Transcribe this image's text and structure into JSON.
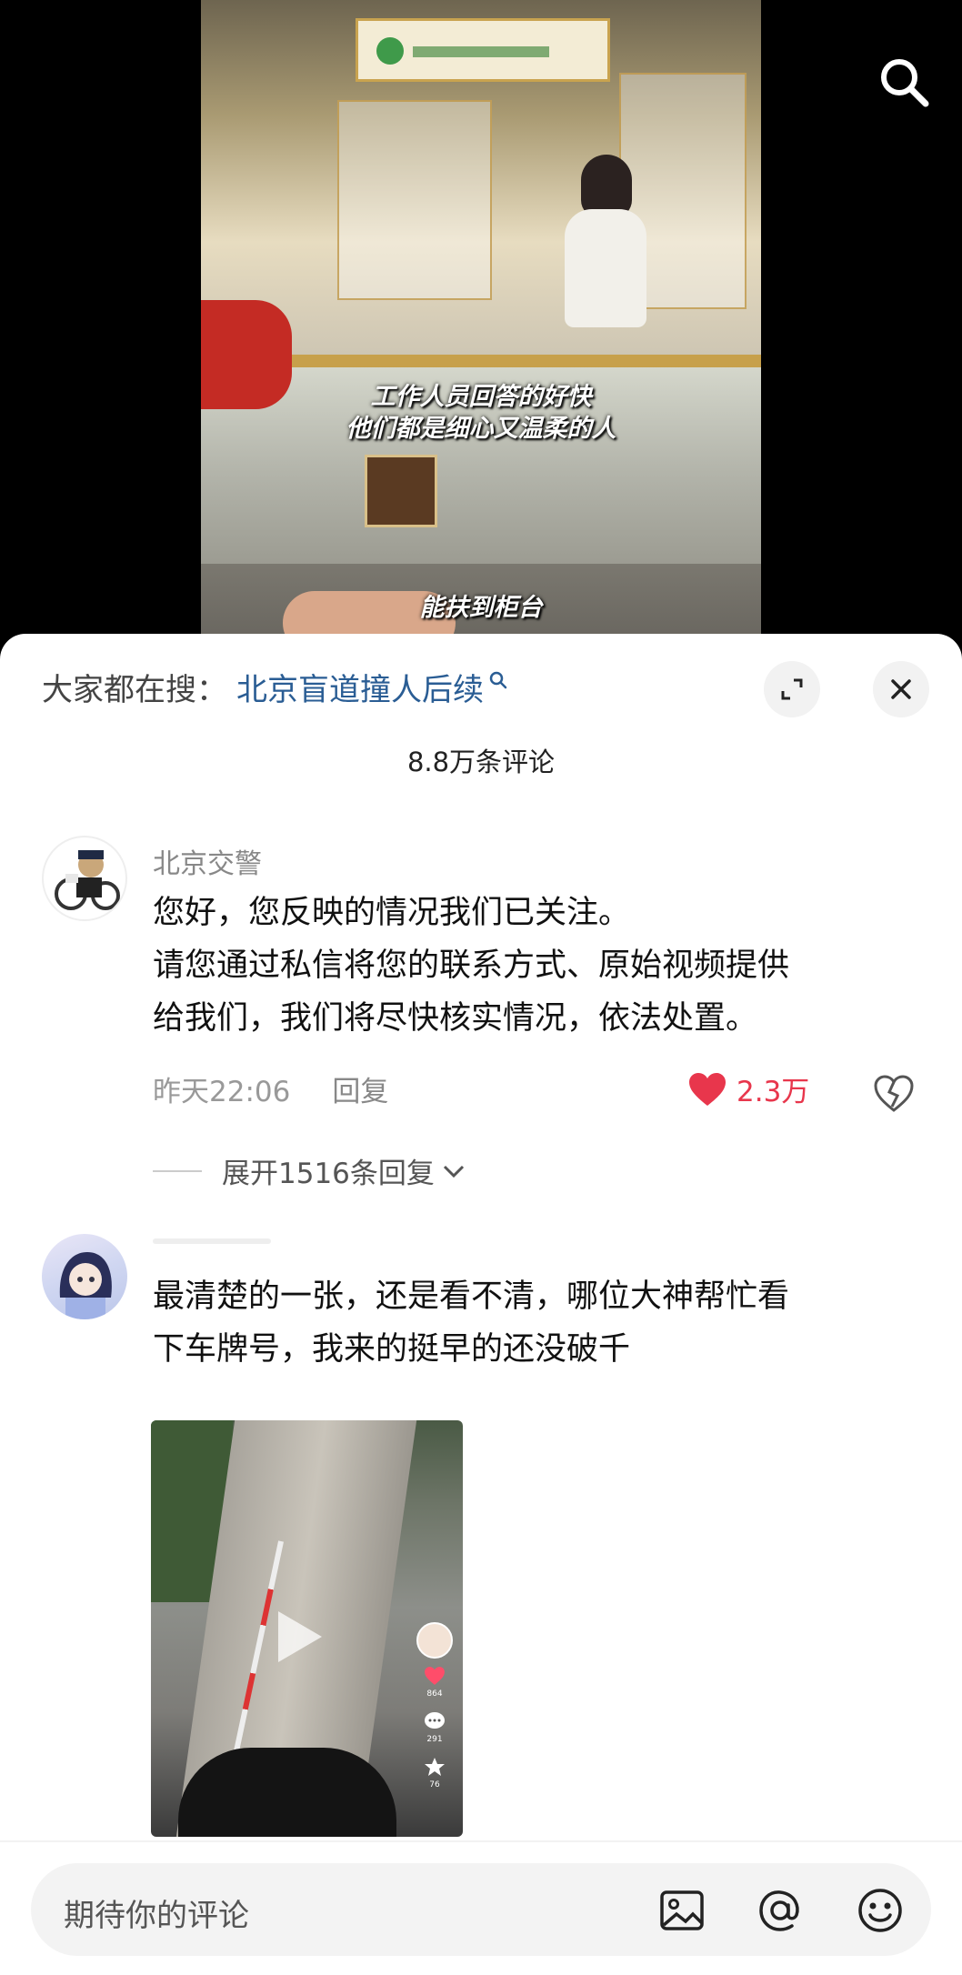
{
  "video": {
    "caption_line_1": "工作人员回答的好快",
    "caption_line_2": "他们都是细心又温柔的人",
    "caption_line_3": "能扶到柜台"
  },
  "header": {
    "trending_label": "大家都在搜：",
    "trending_query": "北京盲道撞人后续",
    "comment_count": "8.8万条评论"
  },
  "comments": [
    {
      "username": "北京交警",
      "text_lines": [
        "您好，您反映的情况我们已关注。",
        "请您通过私信将您的联系方式、原始视频提供",
        "给我们，我们将尽快核实情况，依法处置。"
      ],
      "time": "昨天22:06",
      "reply_label": "回复",
      "like_count": "2.3万",
      "liked": true,
      "expand_replies": "展开1516条回复"
    },
    {
      "username": "",
      "text_lines": [
        "最清楚的一张，还是看不清，哪位大神帮忙看",
        "下车牌号，我来的挺早的还没破千"
      ],
      "image_stats": {
        "likes": "864",
        "comments": "291",
        "favorites": "76"
      }
    }
  ],
  "input": {
    "placeholder": "期待你的评论"
  },
  "colors": {
    "accent_link": "#2a5d94",
    "like_red": "#e8364c"
  },
  "icons": [
    "search-icon",
    "expand-icon",
    "close-icon",
    "heart-icon",
    "broken-heart-icon",
    "chevron-down-icon",
    "image-icon",
    "mention-icon",
    "emoji-icon"
  ]
}
